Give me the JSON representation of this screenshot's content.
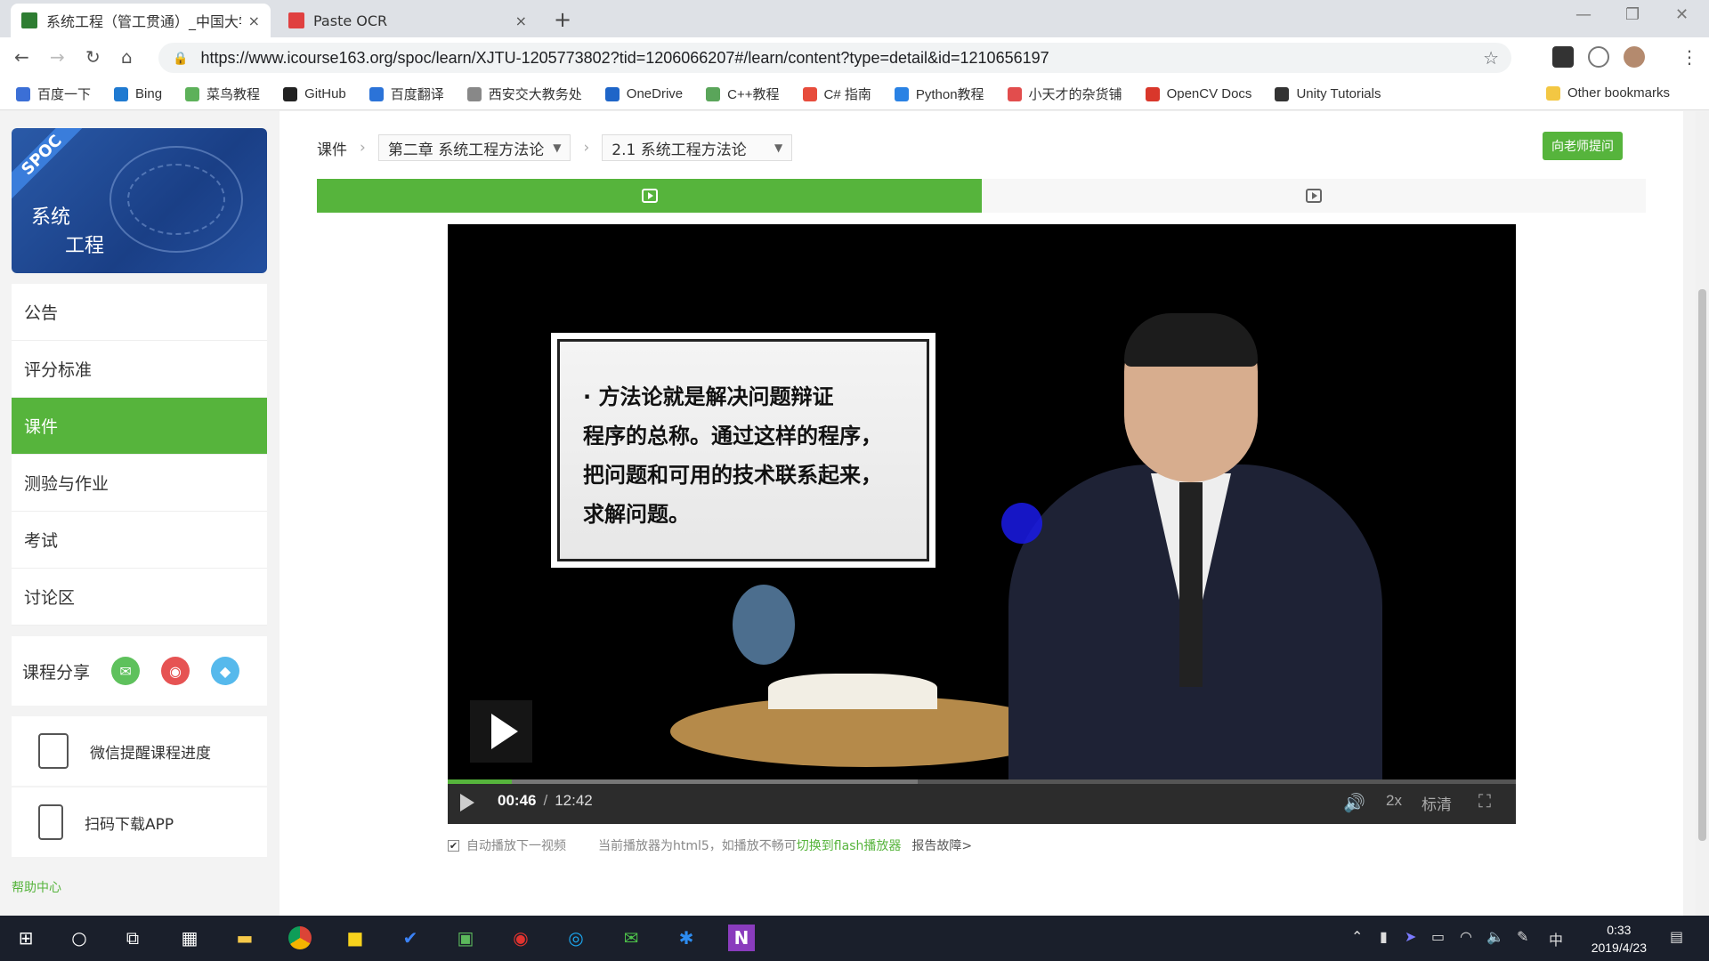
{
  "browser": {
    "tabs": [
      {
        "title": "系统工程（管工贯通）_中国大学",
        "close": "×"
      },
      {
        "title": "Paste OCR",
        "close": "×"
      }
    ],
    "new_tab": "+",
    "url": "https://www.icourse163.org/spoc/learn/XJTU-1205773802?tid=1206066207#/learn/content?type=detail&id=1210656197",
    "bookmarks": [
      "百度一下",
      "Bing",
      "菜鸟教程",
      "GitHub",
      "百度翻译",
      "西安交大教务处",
      "OneDrive",
      "C++教程",
      "C# 指南",
      "Python教程",
      "小天才的杂货铺",
      "OpenCV Docs",
      "Unity Tutorials"
    ],
    "other_bookmarks": "Other bookmarks",
    "bookmark_colors": [
      "#3b6fd6",
      "#1f7ad1",
      "#5db15a",
      "#222222",
      "#2b73d8",
      "#888888",
      "#1e65c8",
      "#5aa55a",
      "#e74c3c",
      "#2a82e4",
      "#e24d4d",
      "#d9372b",
      "#333333"
    ]
  },
  "course": {
    "banner_badge": "SPOC",
    "banner_title_1": "系统",
    "banner_title_2": "工程"
  },
  "sidebar": {
    "menu": [
      {
        "label": "公告",
        "active": false
      },
      {
        "label": "评分标准",
        "active": false
      },
      {
        "label": "课件",
        "active": true
      },
      {
        "label": "测验与作业",
        "active": false
      },
      {
        "label": "考试",
        "active": false
      },
      {
        "label": "讨论区",
        "active": false
      }
    ],
    "share_label": "课程分享",
    "share_icons": [
      "wechat-icon",
      "weibo-icon",
      "qq-icon"
    ],
    "wechat_reminder": "微信提醒课程进度",
    "download_app": "扫码下载APP",
    "help_center": "帮助中心"
  },
  "content": {
    "breadcrumb": {
      "root": "课件",
      "chapter": "第二章 系统工程方法论",
      "section": "2.1 系统工程方法论"
    },
    "ask_teacher": "向老师提问",
    "units": [
      {
        "active": true
      },
      {
        "active": false
      }
    ],
    "slide_lines": [
      "· 方法论就是解决问题辩证",
      "程序的总称。通过这样的程序，",
      "把问题和可用的技术联系起来，",
      "求解问题。"
    ],
    "player": {
      "current_time": "00:46",
      "separator": "/",
      "total_time": "12:42",
      "played_fraction": 0.0604,
      "buffered_fraction": 0.44,
      "speed": "2x",
      "quality": "标清"
    },
    "autoplay_label": "自动播放下一视频",
    "autoplay_checked": true,
    "player_notice": "当前播放器为html5，如播放不畅可",
    "flash_link": "切换到flash播放器",
    "report_link": "报告故障>"
  },
  "taskbar": {
    "time": "0:33",
    "date": "2019/4/23",
    "ime": "中"
  }
}
